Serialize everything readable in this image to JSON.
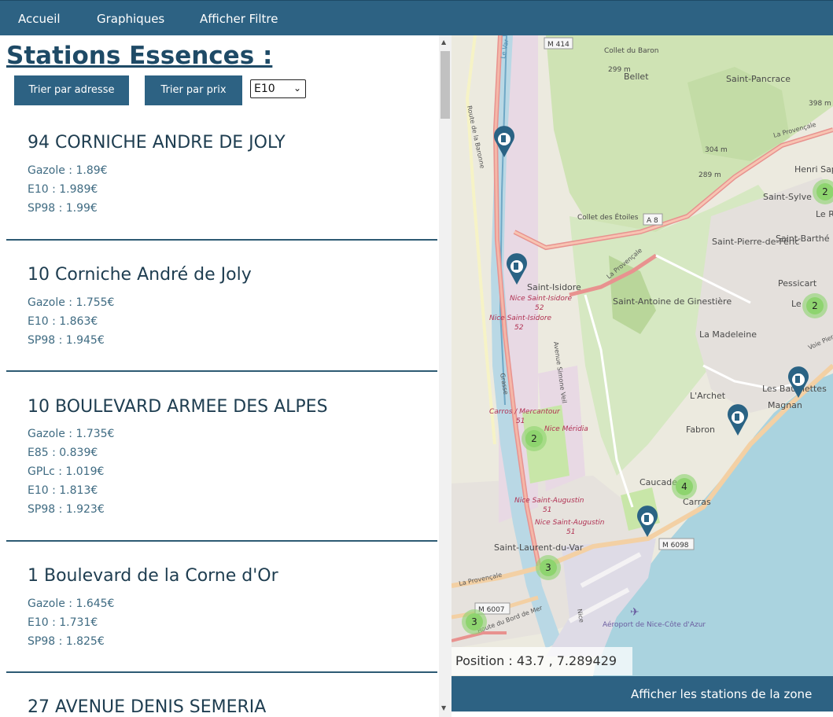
{
  "nav": {
    "items": [
      "Accueil",
      "Graphiques",
      "Afficher Filtre"
    ]
  },
  "page": {
    "title": "Stations Essences :"
  },
  "controls": {
    "sort_address_label": "Trier par adresse",
    "sort_price_label": "Trier par prix",
    "fuel_select_value": "E10"
  },
  "stations": [
    {
      "address": "94 CORNICHE ANDRE DE JOLY",
      "prices": [
        "Gazole : 1.89€",
        "E10 : 1.989€",
        "SP98 : 1.99€"
      ]
    },
    {
      "address": "10 Corniche André de Joly",
      "prices": [
        "Gazole : 1.755€",
        "E10 : 1.863€",
        "SP98 : 1.945€"
      ]
    },
    {
      "address": "10 BOULEVARD ARMEE DES ALPES",
      "prices": [
        "Gazole : 1.735€",
        "E85 : 0.839€",
        "GPLc : 1.019€",
        "E10 : 1.813€",
        "SP98 : 1.923€"
      ]
    },
    {
      "address": "1 Boulevard de la Corne d'Or",
      "prices": [
        "Gazole : 1.645€",
        "E10 : 1.731€",
        "SP98 : 1.825€"
      ]
    },
    {
      "address": "27 AVENUE DENIS SEMERIA",
      "prices": []
    }
  ],
  "map": {
    "position_text": "Position : 43.7 , 7.289429",
    "zone_button_label": "Afficher les stations de la zone",
    "labels": {
      "bellet": "Bellet",
      "saint_pancrace": "Saint-Pancrace",
      "collet_baron": "Collet du Baron",
      "alt_299": "299 m",
      "alt_398": "398 m",
      "alt_304": "304 m",
      "alt_289": "289 m",
      "henri_sappia": "Henri Sap",
      "saint_sylvestre": "Saint-Sylve",
      "le_ray": "Le R",
      "saint_pierre_feric": "Saint-Pierre-de-Féric",
      "saint_barthelemy": "Saint-Barthé",
      "pessicart": "Pessicart",
      "le": "Le",
      "collet_etoiles": "Collet des Étoiles",
      "saint_isidore": "Saint-Isidore",
      "nice_saint_isidore": "Nice Saint-Isidore",
      "route_52": "52",
      "saint_antoine": "Saint-Antoine de Ginestière",
      "la_madeleine": "La Madeleine",
      "larchet": "L'Archet",
      "les_baumettes": "Les Baumettes",
      "magnan": "Magnan",
      "fabron": "Fabron",
      "carros_mercantour": "Carros / Mercantour",
      "route_51": "51",
      "nice_meridia": "Nice Méridia",
      "nice_saint_augustin": "Nice Saint-Augustin",
      "caucade": "Caucade",
      "carras": "Carras",
      "saint_laurent": "Saint-Laurent-du-Var",
      "aeroport": "Aéroport de Nice-Côte d'Azur",
      "la_provencale": "La Provençale",
      "route_bord_mer": "Route du Bord de Mer",
      "grasse": "Grasse",
      "avenue_simone_veil": "Avenue Simone Veil",
      "route_baronne": "Route de la Baronne",
      "le_var": "Le Var",
      "nice": "Nice",
      "voie_pierre": "Voie Pierre",
      "road_m414": "M 414",
      "road_a8": "A 8",
      "road_m6098": "M 6098",
      "road_m6007": "M 6007"
    },
    "clusters": [
      "2",
      "2",
      "2",
      "4",
      "3",
      "3"
    ],
    "colors": {
      "accent": "#2d6283",
      "marker": "#2a6384",
      "cluster": "#8ed46f",
      "sea": "#aad3df"
    }
  }
}
